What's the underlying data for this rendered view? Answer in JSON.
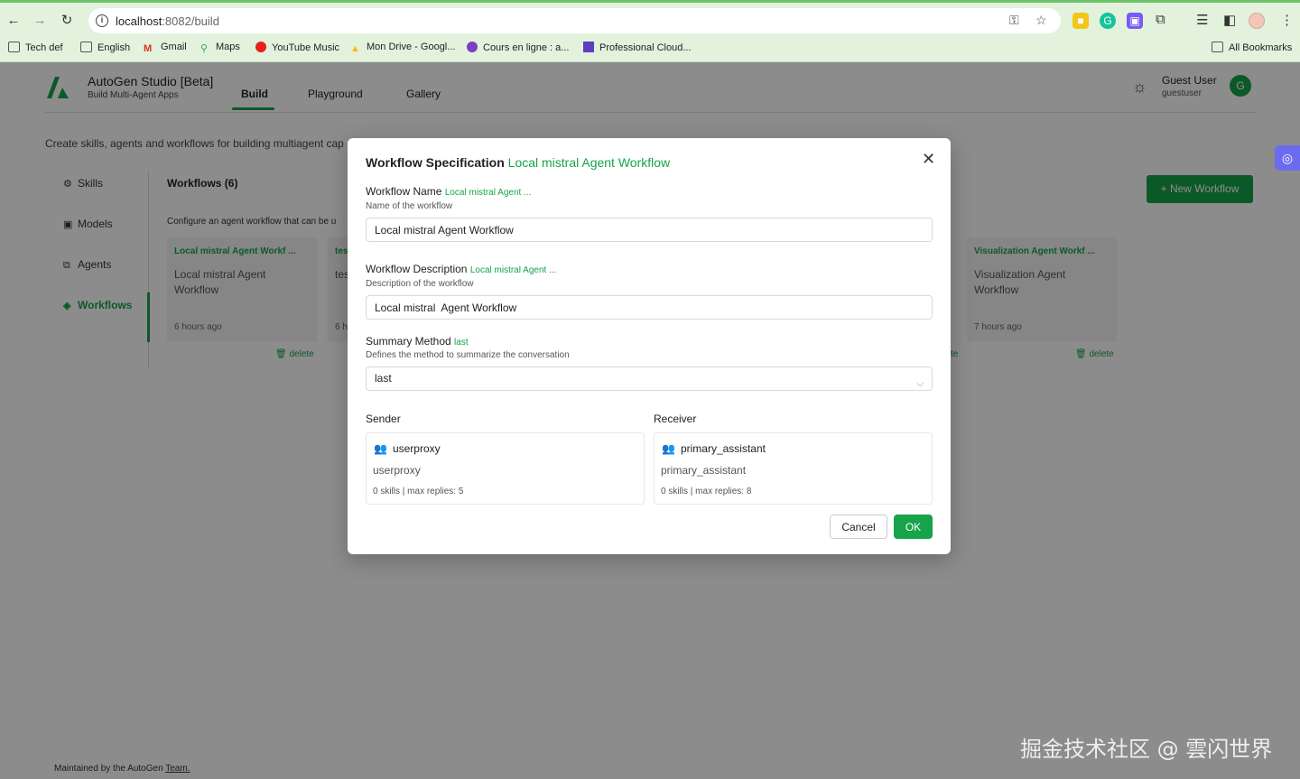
{
  "browser": {
    "url_host": "localhost",
    "url_rest": ":8082/build",
    "bookmarks": [
      {
        "label": "Tech def",
        "icon": "folder-icon"
      },
      {
        "label": "English",
        "icon": "folder-icon"
      },
      {
        "label": "Gmail",
        "icon": "gmail-icon"
      },
      {
        "label": "Maps",
        "icon": "maps-icon"
      },
      {
        "label": "YouTube Music",
        "icon": "youtube-music-icon"
      },
      {
        "label": "Mon Drive - Googl...",
        "icon": "drive-icon"
      },
      {
        "label": "Cours en ligne : a...",
        "icon": "course-icon"
      },
      {
        "label": "Professional Cloud...",
        "icon": "cloud-icon"
      }
    ],
    "all_bookmarks": "All Bookmarks"
  },
  "app": {
    "title": "AutoGen Studio [Beta]",
    "subtitle": "Build Multi-Agent Apps",
    "tabs": [
      "Build",
      "Playground",
      "Gallery"
    ],
    "user_name": "Guest User",
    "user_handle": "guestuser",
    "avatar_letter": "G",
    "page_desc": "Create skills, agents and workflows for building multiagent cap",
    "sidebar": [
      "Skills",
      "Models",
      "Agents",
      "Workflows"
    ],
    "workflows_title": "Workflows (6)",
    "workflows_desc": "Configure an agent workflow that can be u",
    "new_workflow": "New Workflow",
    "cards": [
      {
        "title": "Local mistral Agent Workf ...",
        "body": "Local mistral Agent Workflow",
        "time": "6 hours ago",
        "delete": "delete"
      },
      {
        "title": "tes",
        "body": "tes",
        "time": "6 h",
        "delete": ""
      },
      {
        "title": "Visualization Agent Workf ...",
        "body": "Visualization Agent Workflow",
        "time": "7 hours ago",
        "delete": "delete"
      }
    ],
    "partial_delete": "te",
    "footer_prefix": "Maintained by the AutoGen ",
    "footer_link": "Team.",
    "accent_color": "#16a34a"
  },
  "modal": {
    "title": "Workflow Specification",
    "title_accent": "Local mistral Agent Workflow",
    "name_label": "Workflow Name",
    "name_accent": "Local mistral Agent ...",
    "name_help": "Name of the workflow",
    "name_value": "Local mistral Agent Workflow",
    "desc_label": "Workflow Description",
    "desc_accent": "Local mistral Agent ...",
    "desc_help": "Description of the workflow",
    "desc_value": "Local mistral  Agent Workflow",
    "summary_label": "Summary Method",
    "summary_accent": "last",
    "summary_help": "Defines the method to summarize the conversation",
    "summary_value": "last",
    "sender_label": "Sender",
    "receiver_label": "Receiver",
    "sender": {
      "name": "userproxy",
      "desc": "userproxy",
      "skills": "0 skills",
      "replies": "| max replies: 5"
    },
    "receiver": {
      "name": "primary_assistant",
      "desc": "primary_assistant",
      "skills": "0 skills",
      "replies": "| max replies: 8"
    },
    "cancel": "Cancel",
    "ok": "OK"
  },
  "watermark": "掘金技术社区 @ 雲闪世界"
}
